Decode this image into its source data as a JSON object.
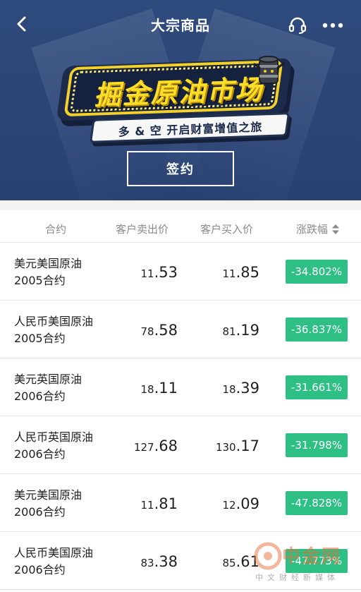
{
  "header": {
    "title": "大宗商品",
    "back_icon": "chevron-left-icon",
    "support_icon": "headset-icon",
    "more_icon": "more-dots-icon"
  },
  "banner": {
    "title": "掘金原油市场",
    "subtitle": "多 & 空  开启财富增值之旅",
    "sign_button": "签约"
  },
  "table": {
    "headers": {
      "contract": "合约",
      "sell": "客户卖出价",
      "buy": "客户买入价",
      "change": "涨跌幅"
    },
    "rows": [
      {
        "name_line1": "美元美国原油",
        "name_line2": "2005合约",
        "sell_int": "11",
        "sell_dec": ".53",
        "buy_int": "11",
        "buy_dec": ".85",
        "change": "-34.802%"
      },
      {
        "name_line1": "人民币美国原油",
        "name_line2": "2005合约",
        "sell_int": "78",
        "sell_dec": ".58",
        "buy_int": "81",
        "buy_dec": ".19",
        "change": "-36.837%"
      },
      {
        "name_line1": "美元英国原油",
        "name_line2": "2006合约",
        "sell_int": "18",
        "sell_dec": ".11",
        "buy_int": "18",
        "buy_dec": ".39",
        "change": "-31.661%"
      },
      {
        "name_line1": "人民币英国原油",
        "name_line2": "2006合约",
        "sell_int": "127",
        "sell_dec": ".68",
        "buy_int": "130",
        "buy_dec": ".17",
        "change": "-31.798%"
      },
      {
        "name_line1": "美元美国原油",
        "name_line2": "2006合约",
        "sell_int": "11",
        "sell_dec": ".81",
        "buy_int": "12",
        "buy_dec": ".09",
        "change": "-47.828%"
      },
      {
        "name_line1": "人民币美国原油",
        "name_line2": "2006合约",
        "sell_int": "83",
        "sell_dec": ".38",
        "buy_int": "85",
        "buy_dec": ".61",
        "change": "-47.773%"
      }
    ]
  },
  "watermark": {
    "name": "中金网",
    "sub": "中文财经新媒体"
  },
  "colors": {
    "header_bg": "#2c4577",
    "badge_green": "#2dbf83",
    "banner_yellow": "#ffde2a"
  }
}
